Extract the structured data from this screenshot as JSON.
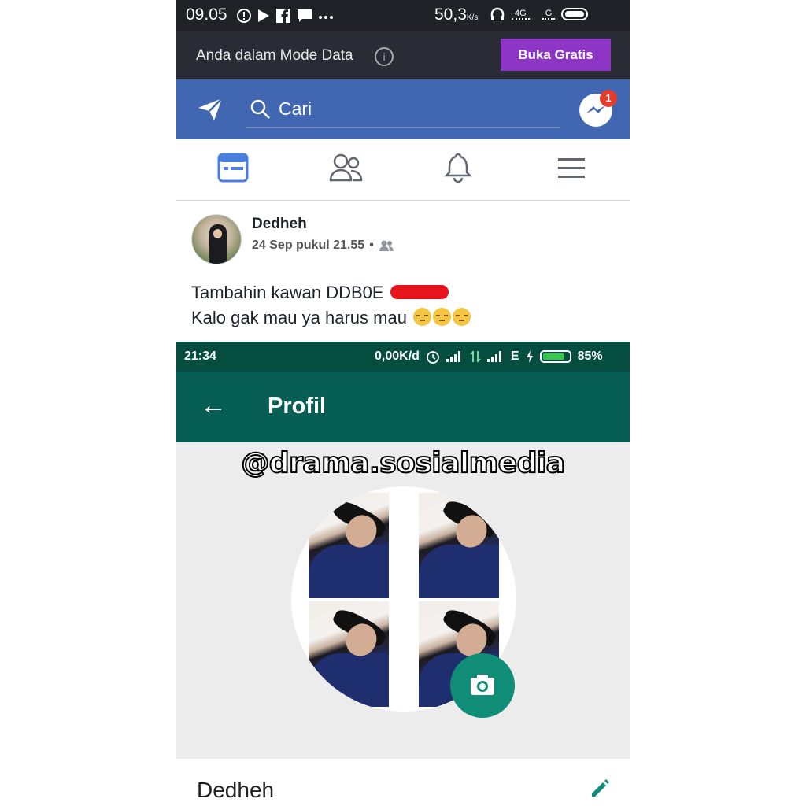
{
  "status_bar": {
    "time": "09.05",
    "speed": "50,3",
    "speed_unit": "K/s",
    "network_1": "4G",
    "network_2": "G",
    "icons": [
      "alert-icon",
      "play-icon",
      "facebook-icon",
      "chat-icon",
      "more-icon",
      "headphones-icon",
      "battery-icon"
    ]
  },
  "data_mode_bar": {
    "text": "Anda dalam Mode Data",
    "button_label": "Buka Gratis"
  },
  "header": {
    "search_placeholder": "Cari",
    "messenger_badge": "1"
  },
  "nav_tabs": [
    {
      "name": "news-feed",
      "active": true
    },
    {
      "name": "friends",
      "active": false
    },
    {
      "name": "notifications",
      "active": false
    },
    {
      "name": "menu",
      "active": false
    }
  ],
  "post": {
    "author": "Dedheh",
    "timestamp": "24 Sep pukul 21.55",
    "separator": "•",
    "line1": "Tambahin kawan DDB0E",
    "line2": "Kalo gak mau ya harus mau"
  },
  "embedded_screenshot": {
    "status_time": "21:34",
    "status_speed": "0,00K/d",
    "network": "E",
    "battery": "85%",
    "title": "Profil",
    "watermark": "@drama.sosialmedia",
    "profile_name": "Dedheh"
  },
  "colors": {
    "facebook_blue": "#4267b2",
    "whatsapp_green": "#075e54",
    "accent_purple": "#8d35c4",
    "camera_fab": "#0f8d77"
  }
}
